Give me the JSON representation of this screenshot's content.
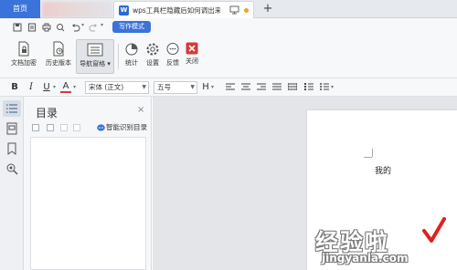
{
  "tabs": {
    "home_label": "首页",
    "doc_title": "wps工具栏隐藏后如何调出来",
    "new_tab": "+"
  },
  "quickbar": {
    "writing_mode": "写作模式"
  },
  "ribbon": {
    "buttons": [
      {
        "label": "文档加密",
        "icon": "doc-lock-icon"
      },
      {
        "label": "历史版本",
        "icon": "doc-history-icon"
      },
      {
        "label": "导航窗格",
        "icon": "nav-pane-icon",
        "selected": true
      },
      {
        "label": "统计",
        "icon": "pie-chart-icon"
      },
      {
        "label": "设置",
        "icon": "gear-icon"
      },
      {
        "label": "反馈",
        "icon": "chat-icon"
      },
      {
        "label": "关闭",
        "icon": "close-icon"
      }
    ]
  },
  "format": {
    "bold": "B",
    "italic": "I",
    "underline": "U",
    "font_color": "A",
    "font_name": "宋体 (正文)",
    "font_size": "五号",
    "heading": "H"
  },
  "toc": {
    "title": "目录",
    "close": "×",
    "smart_label": "智能识别目录"
  },
  "document": {
    "text": "我的"
  },
  "watermark": {
    "main": "经验啦",
    "sub": "jingyanla.com"
  },
  "colors": {
    "accent": "#3a73d9",
    "close_red": "#d9383a",
    "canvas_gray": "#e3e5e8"
  }
}
